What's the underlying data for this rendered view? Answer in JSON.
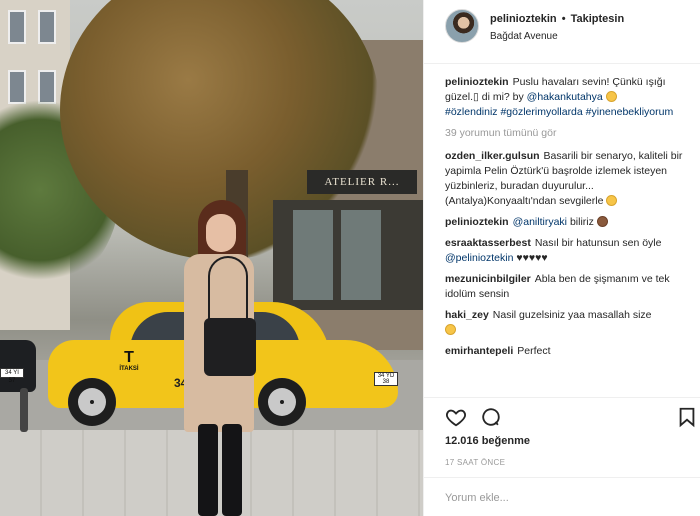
{
  "header": {
    "username": "pelinioztekin",
    "separator": "•",
    "follow_status": "Takiptesin",
    "location": "Bağdat Avenue"
  },
  "photo": {
    "shop_sign": "ATELIER R...",
    "taxi_logo": "İTAKSİ",
    "taxi_number": "34",
    "left_plate": "34 YI 57",
    "right_plate": "34 YD 38"
  },
  "caption": {
    "username": "pelinioztekin",
    "text": "Puslu havaları sevin! Çünkü ışığı güzel.",
    "text2": " di mi? by ",
    "mention": "@hakankutahya",
    "hashtags": "#özlendiniz #gözlerimyollarda #yinenebekliyorum"
  },
  "view_all_comments": "39 yorumun tümünü gör",
  "comments": [
    {
      "username": "ozden_ilker.gulsun",
      "text": "Basarili bir senaryo, kaliteli bir yapimla Pelin Öztürk'ü başrolde izlemek isteyen yüzbinleriz, buradan duyurulur... (Antalya)Konyaaltı'ndan sevgilerle"
    },
    {
      "username": "pelinioztekin",
      "mention": "@aniltiryaki",
      "text": " biliriz"
    },
    {
      "username": "esraaktasserbest",
      "text": "Nasıl bir hatunsun sen öyle ",
      "mention": "@pelinioztekin",
      "hearts": "♥♥♥♥♥"
    },
    {
      "username": "mezunicinbilgiler",
      "text": "Abla ben de şişmanım ve tek idolüm sensin"
    },
    {
      "username": "haki_zey",
      "text": "Nasil guzelsiniz yaa masallah size"
    },
    {
      "username": "emirhantepeli",
      "text": "Perfect"
    }
  ],
  "likes": "12.016 beğenme",
  "timestamp": "17 SAAT ÖNCE",
  "add_comment_placeholder": "Yorum ekle...",
  "icons": {
    "like": "heart-icon",
    "comment": "comment-icon",
    "save": "bookmark-icon"
  },
  "colors": {
    "text": "#262626",
    "muted": "#999999",
    "link": "#003569",
    "border": "#efefef"
  }
}
